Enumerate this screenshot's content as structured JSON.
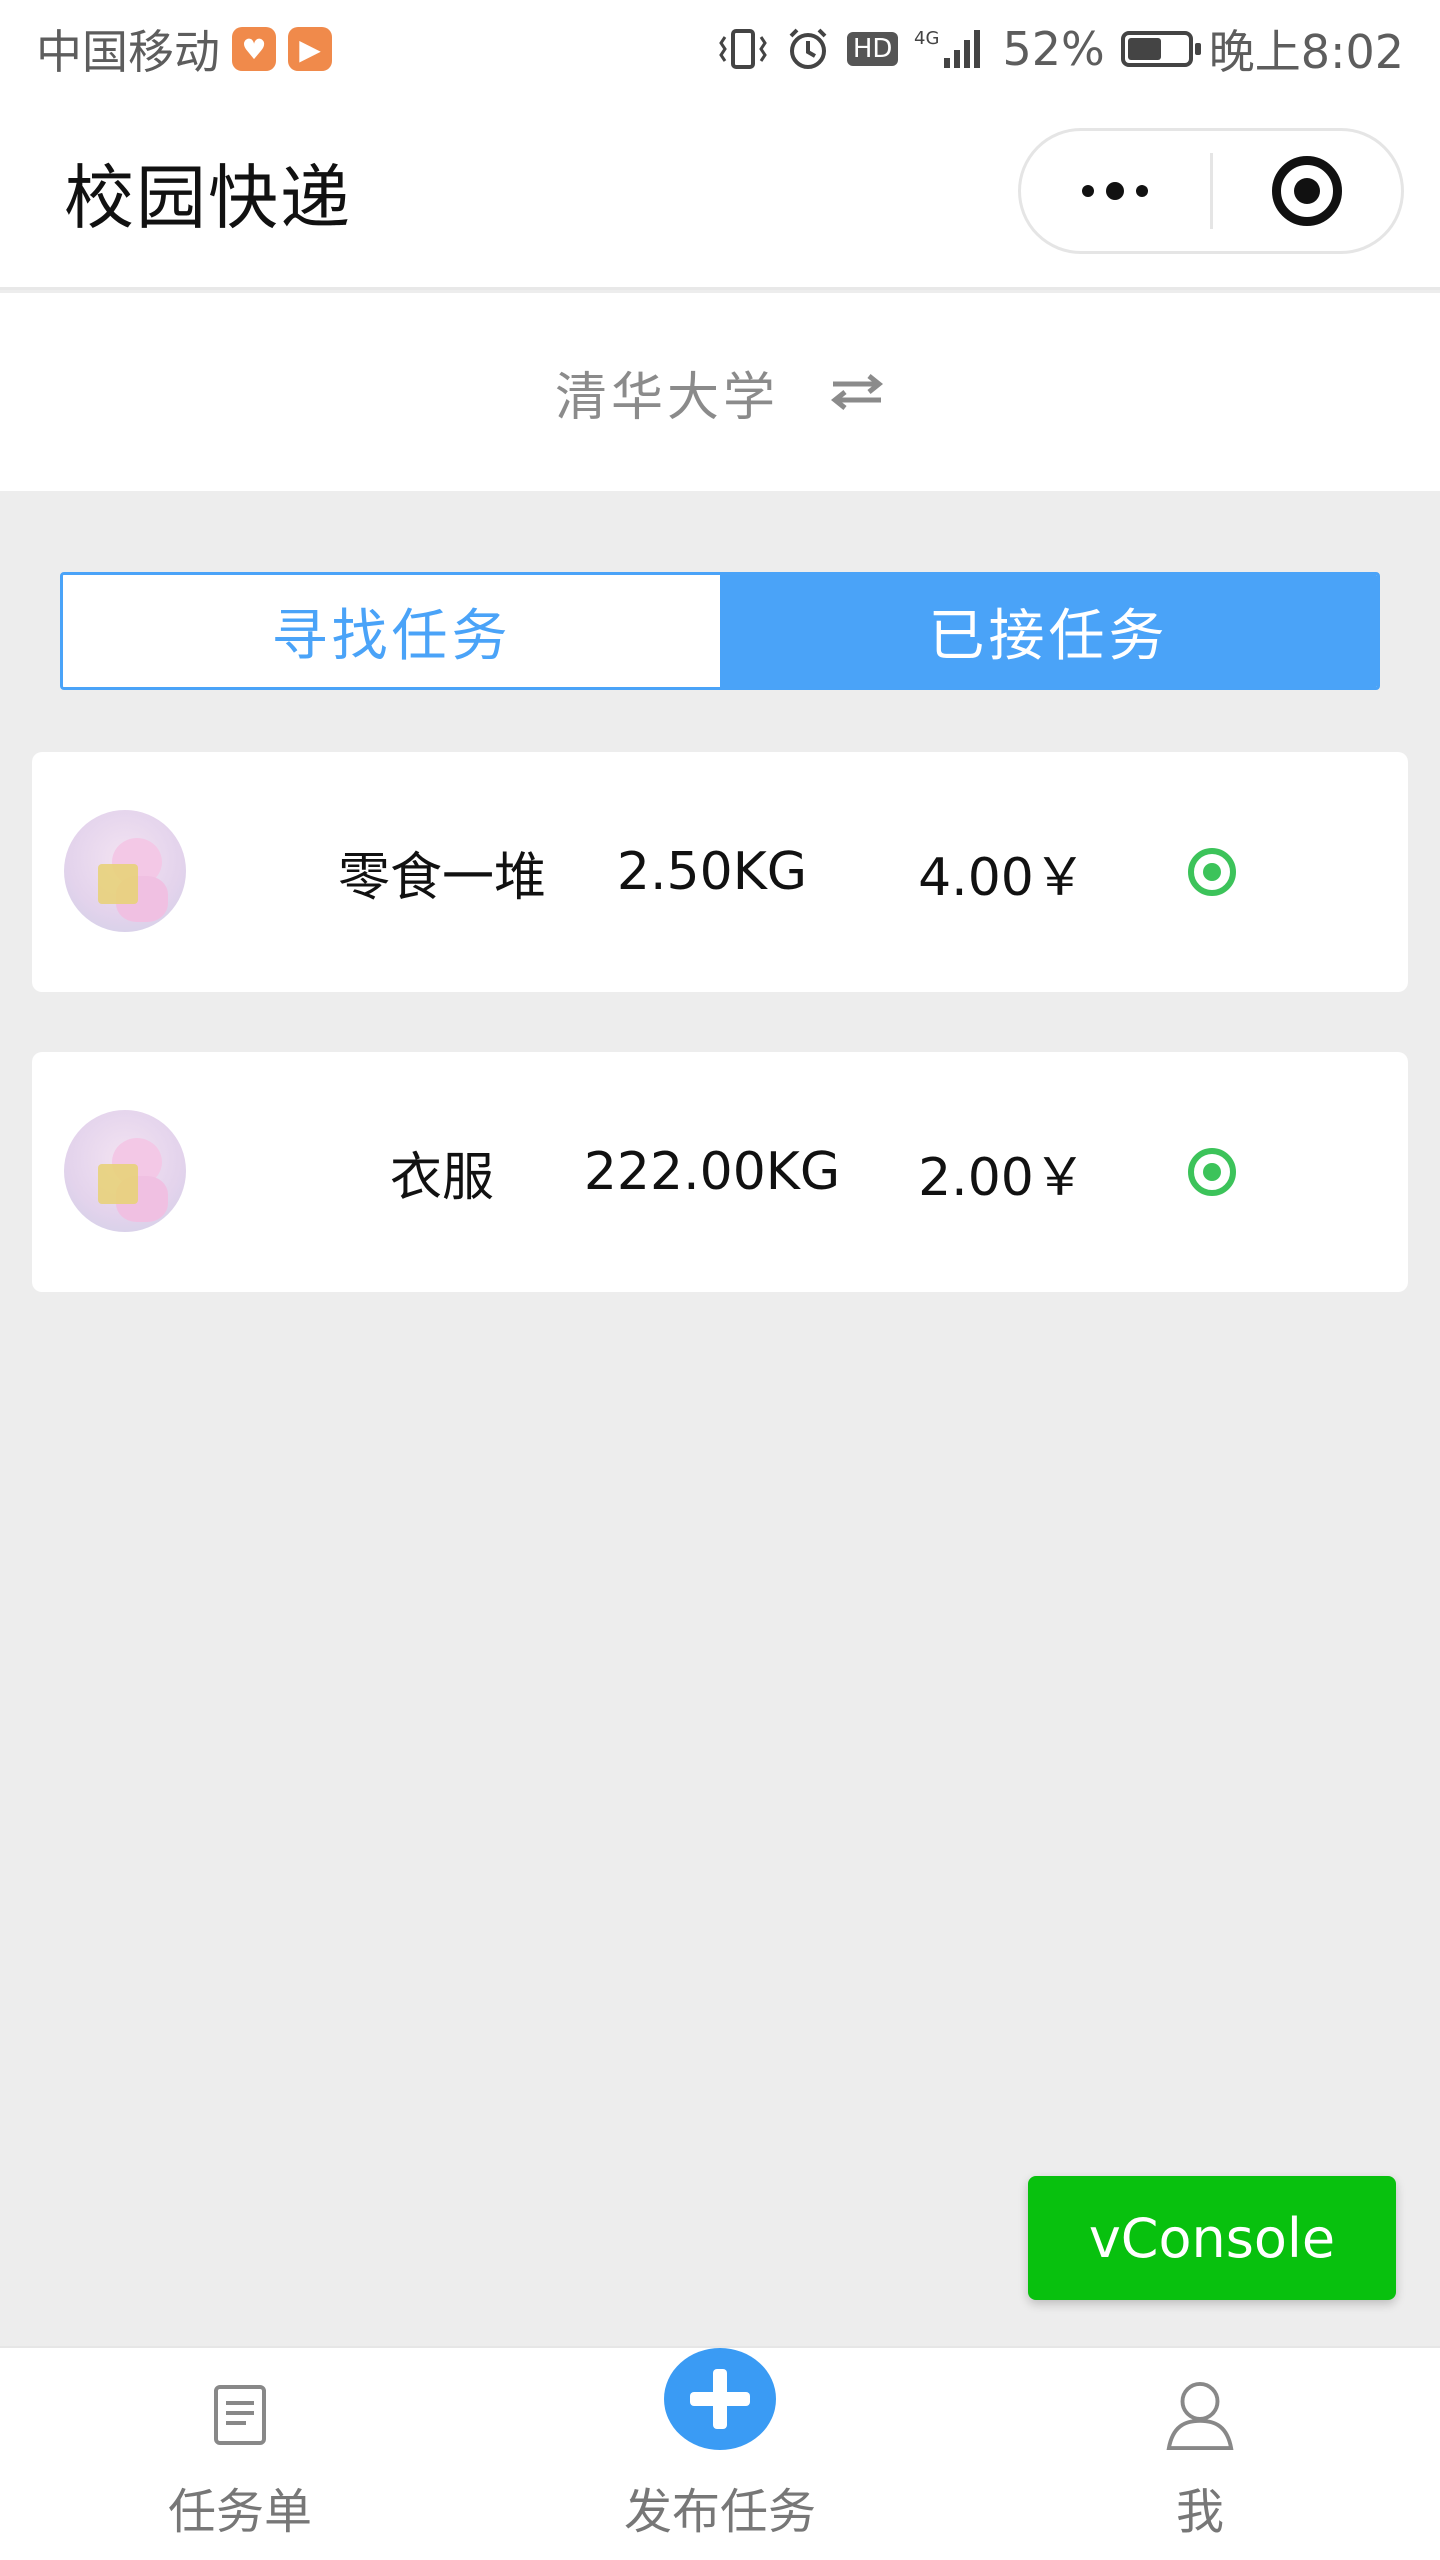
{
  "status_bar": {
    "carrier": "中国移动",
    "battery_percent": "52%",
    "battery_level": 0.52,
    "time": "晚上8:02",
    "hd_label": "HD",
    "network_label": "4G"
  },
  "nav": {
    "title": "校园快递"
  },
  "school": {
    "name": "清华大学"
  },
  "tabs": [
    {
      "label": "寻找任务",
      "active": false
    },
    {
      "label": "已接任务",
      "active": true
    }
  ],
  "tasks": [
    {
      "name": "零食一堆",
      "weight": "2.50KG",
      "price": "4.00￥"
    },
    {
      "name": "衣服",
      "weight": "222.00KG",
      "price": "2.00￥"
    }
  ],
  "vconsole": {
    "label": "vConsole"
  },
  "tab_bar": {
    "items": [
      {
        "label": "任务单",
        "icon": "document-icon"
      },
      {
        "label": "发布任务",
        "icon": "plus-circle-icon"
      },
      {
        "label": "我",
        "icon": "user-icon"
      }
    ]
  },
  "colors": {
    "accent_blue": "#4aa3f8",
    "green": "#08c10e",
    "radio_green": "#3cc35a"
  }
}
